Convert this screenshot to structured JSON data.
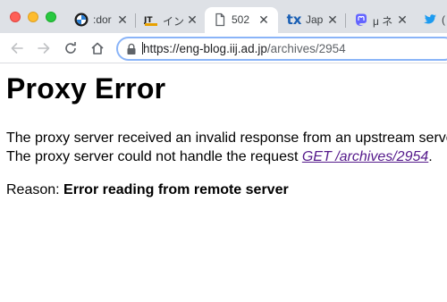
{
  "tabs": [
    {
      "title": ":dor",
      "icon": "bmw-icon"
    },
    {
      "title": "イン",
      "icon": "jtbc-icon"
    },
    {
      "title": "502",
      "icon": "document-icon",
      "active": true
    },
    {
      "title": "Jap",
      "icon": "tx-icon",
      "icon_text": "tx"
    },
    {
      "title": "μ ネ",
      "icon": "mastodon-icon"
    },
    {
      "title": "(",
      "icon": "twitter-icon"
    }
  ],
  "address_bar": {
    "host": "https://eng-blog.iij.ad.jp",
    "path": "/archives/2954"
  },
  "page": {
    "heading": "Proxy Error",
    "line1": "The proxy server received an invalid response from an upstream server.",
    "line2_prefix": "The proxy server could not handle the request ",
    "request_link": "GET /archives/2954",
    "line2_suffix": ".",
    "reason_label": "Reason:",
    "reason_text": "Error reading from remote server"
  },
  "colors": {
    "tabstrip_bg": "#dee1e6",
    "link_visited": "#551a8b",
    "omnibox_focus": "#8ab4f8",
    "twitter_blue": "#1d9bf0",
    "mastodon_blue": "#6364ff",
    "tx_blue": "#1a5fb4"
  }
}
